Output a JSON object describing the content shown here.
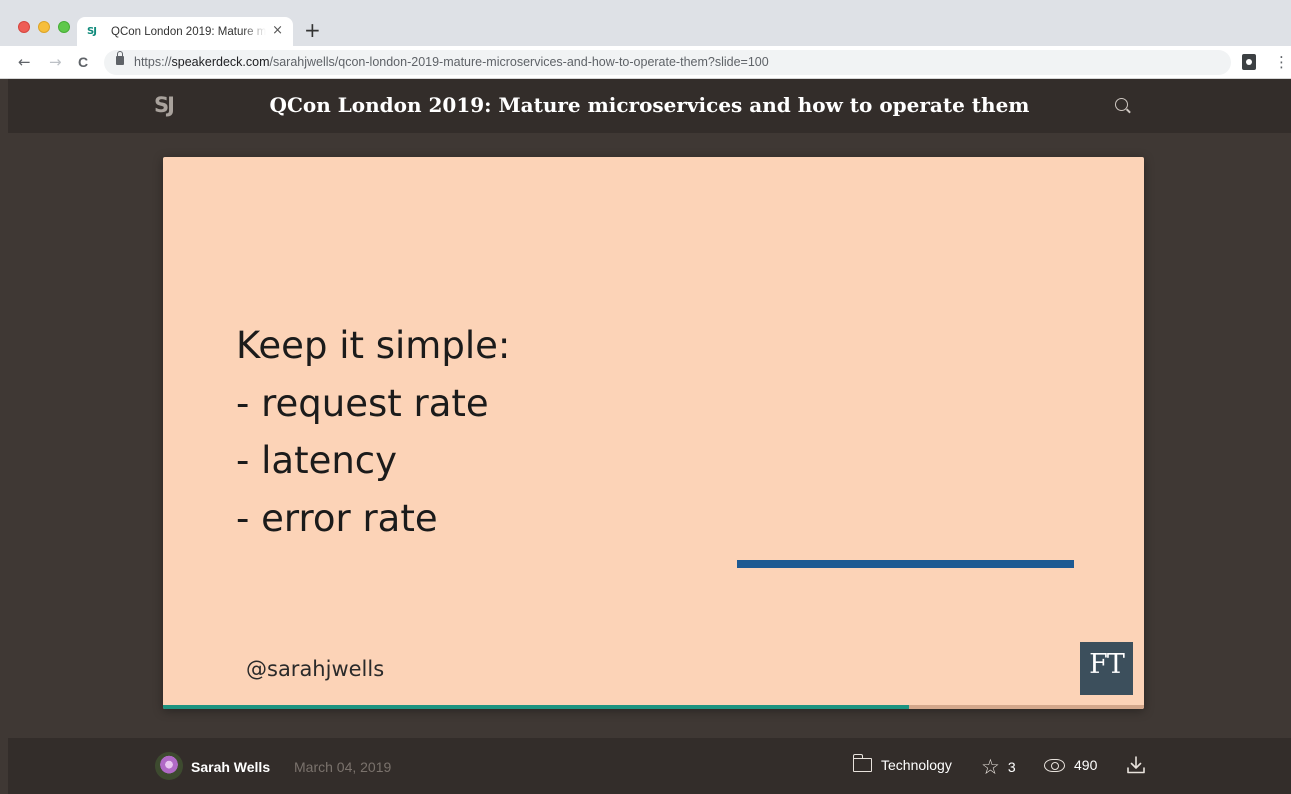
{
  "browser": {
    "tab": {
      "favicon_text": "SJ",
      "title": "QCon London 2019: Mature microservices and how to operate them",
      "close_glyph": "×"
    },
    "new_tab_glyph": "+",
    "nav": {
      "back": "←",
      "forward": "→",
      "reload": "C"
    },
    "url": {
      "scheme": "https://",
      "host": "speakerdeck.com",
      "path": "/sarahjwells/qcon-london-2019-mature-microservices-and-how-to-operate-them?slide=100"
    },
    "menu_glyph": "⋮"
  },
  "header": {
    "logo_text": "SJ",
    "title": "QCon London 2019: Mature microservices and how to operate them"
  },
  "slide": {
    "lines": [
      "Keep it simple:",
      "- request rate",
      "- latency",
      "- error rate"
    ],
    "handle": "@sarahjwells",
    "ft_logo": "FT",
    "progress_fraction": 0.76,
    "colors": {
      "background": "#fcd3b7",
      "bar": "#1e5a92",
      "progress": "#1c9480"
    }
  },
  "footer": {
    "author": "Sarah Wells",
    "date": "March 04, 2019",
    "category": "Technology",
    "stars": "3",
    "views": "490"
  },
  "icons": [
    "search-icon",
    "folder-icon",
    "star-icon",
    "eye-icon",
    "download-icon",
    "lock-icon"
  ]
}
